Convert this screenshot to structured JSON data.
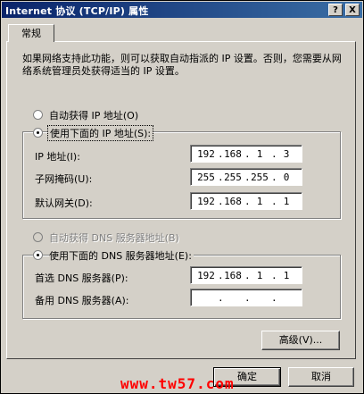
{
  "window": {
    "title": "Internet 协议 (TCP/IP) 属性",
    "help_btn": "?",
    "close_btn": "X"
  },
  "tabs": [
    {
      "label": "常规"
    }
  ],
  "description": "如果网络支持此功能，则可以获取自动指派的 IP 设置。否则，您需要从网络系统管理员处获得适当的 IP 设置。",
  "ip_section": {
    "auto_label": "自动获得 IP 地址(O)",
    "manual_label": "使用下面的 IP 地址(S):",
    "selected": "manual",
    "fields": [
      {
        "label": "IP 地址(I):",
        "octets": [
          "192",
          "168",
          "1",
          "3"
        ]
      },
      {
        "label": "子网掩码(U):",
        "octets": [
          "255",
          "255",
          "255",
          "0"
        ]
      },
      {
        "label": "默认网关(D):",
        "octets": [
          "192",
          "168",
          "1",
          "1"
        ]
      }
    ]
  },
  "dns_section": {
    "auto_label": "自动获得 DNS 服务器地址(B)",
    "manual_label": "使用下面的 DNS 服务器地址(E):",
    "selected": "manual",
    "fields": [
      {
        "label": "首选 DNS 服务器(P):",
        "octets": [
          "192",
          "168",
          "1",
          "1"
        ]
      },
      {
        "label": "备用 DNS 服务器(A):",
        "octets": [
          "",
          "",
          "",
          ""
        ]
      }
    ]
  },
  "buttons": {
    "advanced": "高级(V)...",
    "ok": "确定",
    "cancel": "取消"
  },
  "watermark": "www.tw57.com"
}
